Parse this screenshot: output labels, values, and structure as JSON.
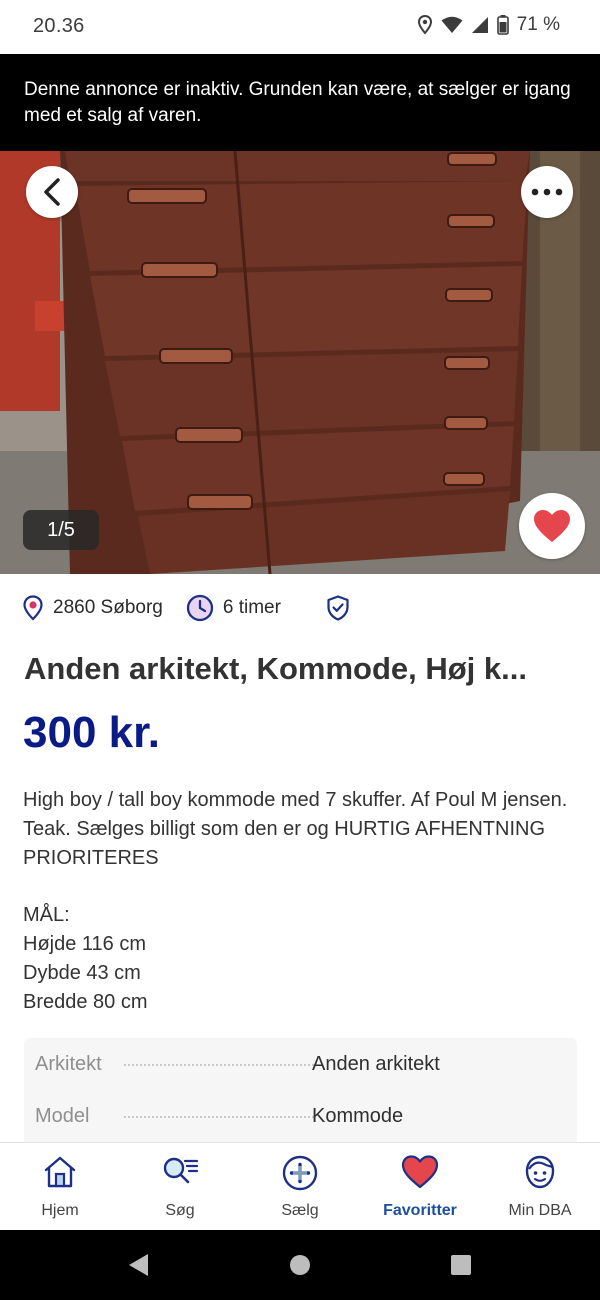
{
  "status_bar": {
    "time": "20.36",
    "battery": "71 %",
    "icons": [
      "location-icon",
      "wifi-icon",
      "signal-icon",
      "battery-icon"
    ]
  },
  "banner": {
    "text": "Denne annonce er inaktiv. Grunden kan være, at sælger er igang med et salg af varen."
  },
  "gallery": {
    "counter": "1/5",
    "icons": [
      "back-arrow-icon",
      "more-dots-icon",
      "heart-icon"
    ]
  },
  "meta": {
    "location": "2860 Søborg",
    "time_ago": "6 timer",
    "icons": [
      "location-pin-icon",
      "clock-icon",
      "verified-shield-icon"
    ]
  },
  "listing": {
    "title": "Anden arkitekt, Kommode, Høj k...",
    "price": "300 kr.",
    "description": "High boy / tall boy kommode med 7 skuffer. Af Poul M jensen. Teak. Sælges billigt som den er og HURTIG AFHENTNING PRIORITERES\n\nMÅL:\nHøjde 116 cm\nDybde 43 cm\nBredde 80 cm"
  },
  "specs": [
    {
      "key": "Arkitekt",
      "value": "Anden arkitekt"
    },
    {
      "key": "Model",
      "value": "Kommode"
    }
  ],
  "bottom_nav": {
    "items": [
      {
        "label": "Hjem",
        "icon": "home-icon"
      },
      {
        "label": "Søg",
        "icon": "search-list-icon"
      },
      {
        "label": "Sælg",
        "icon": "plus-circle-icon"
      },
      {
        "label": "Favoritter",
        "icon": "heart-icon",
        "active": true
      },
      {
        "label": "Min DBA",
        "icon": "profile-face-icon"
      }
    ]
  },
  "colors": {
    "price": "#0b1b86",
    "active_nav": "#1d4fa0",
    "heart": "#e5464d",
    "banner_bg": "#000000"
  }
}
